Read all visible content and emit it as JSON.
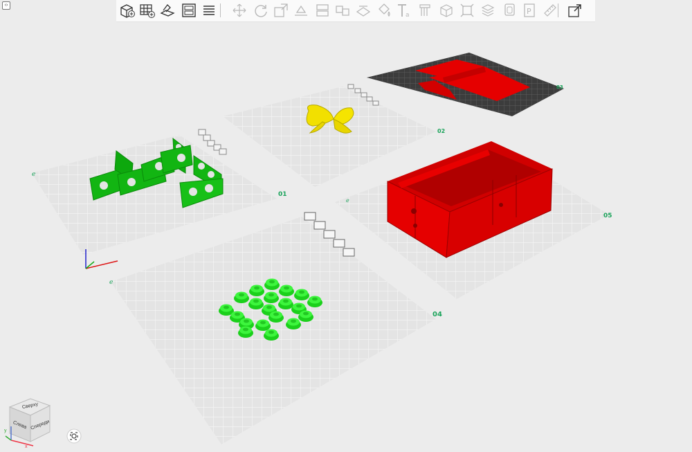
{
  "toolbar": {
    "tools": [
      {
        "name": "add-object-icon",
        "enabled": true
      },
      {
        "name": "add-plate-icon",
        "enabled": true
      },
      {
        "name": "auto-arrange-icon",
        "enabled": true
      },
      {
        "name": "plate-settings-icon",
        "enabled": true
      },
      {
        "name": "layers-icon",
        "enabled": true
      },
      {
        "name": "move-icon",
        "enabled": false
      },
      {
        "name": "rotate-icon",
        "enabled": false
      },
      {
        "name": "scale-icon",
        "enabled": false
      },
      {
        "name": "lay-on-face-icon",
        "enabled": false
      },
      {
        "name": "split-icon",
        "enabled": false
      },
      {
        "name": "mirror-icon",
        "enabled": false
      },
      {
        "name": "cut-icon",
        "enabled": false
      },
      {
        "name": "paint-icon",
        "enabled": false
      },
      {
        "name": "text-icon",
        "enabled": false
      },
      {
        "name": "support-icon",
        "enabled": false
      },
      {
        "name": "box-icon",
        "enabled": false
      },
      {
        "name": "fit-icon",
        "enabled": false
      },
      {
        "name": "slice-icon",
        "enabled": false
      },
      {
        "name": "copy-icon",
        "enabled": false
      },
      {
        "name": "paste-icon",
        "enabled": false
      },
      {
        "name": "measure-icon",
        "enabled": false
      },
      {
        "name": "export-icon",
        "enabled": true
      }
    ]
  },
  "plates": [
    {
      "id": "plate-01",
      "label": "01"
    },
    {
      "id": "plate-02",
      "label": "02"
    },
    {
      "id": "plate-03",
      "label": "03"
    },
    {
      "id": "plate-04",
      "label": "04"
    },
    {
      "id": "plate-05",
      "label": "05"
    }
  ],
  "view_cube": {
    "top": "Сверху",
    "front": "Спереди",
    "left": "Слева",
    "axis_x": "x",
    "axis_y": "y"
  },
  "colors": {
    "green": "#12b512",
    "bright_green": "#2ce52c",
    "yellow": "#f2e000",
    "red": "#e50000",
    "plate": "#e4e4e4",
    "grid": "#f4f4f4",
    "dark_plate": "#3c3c3c",
    "label": "#1aa35a"
  }
}
